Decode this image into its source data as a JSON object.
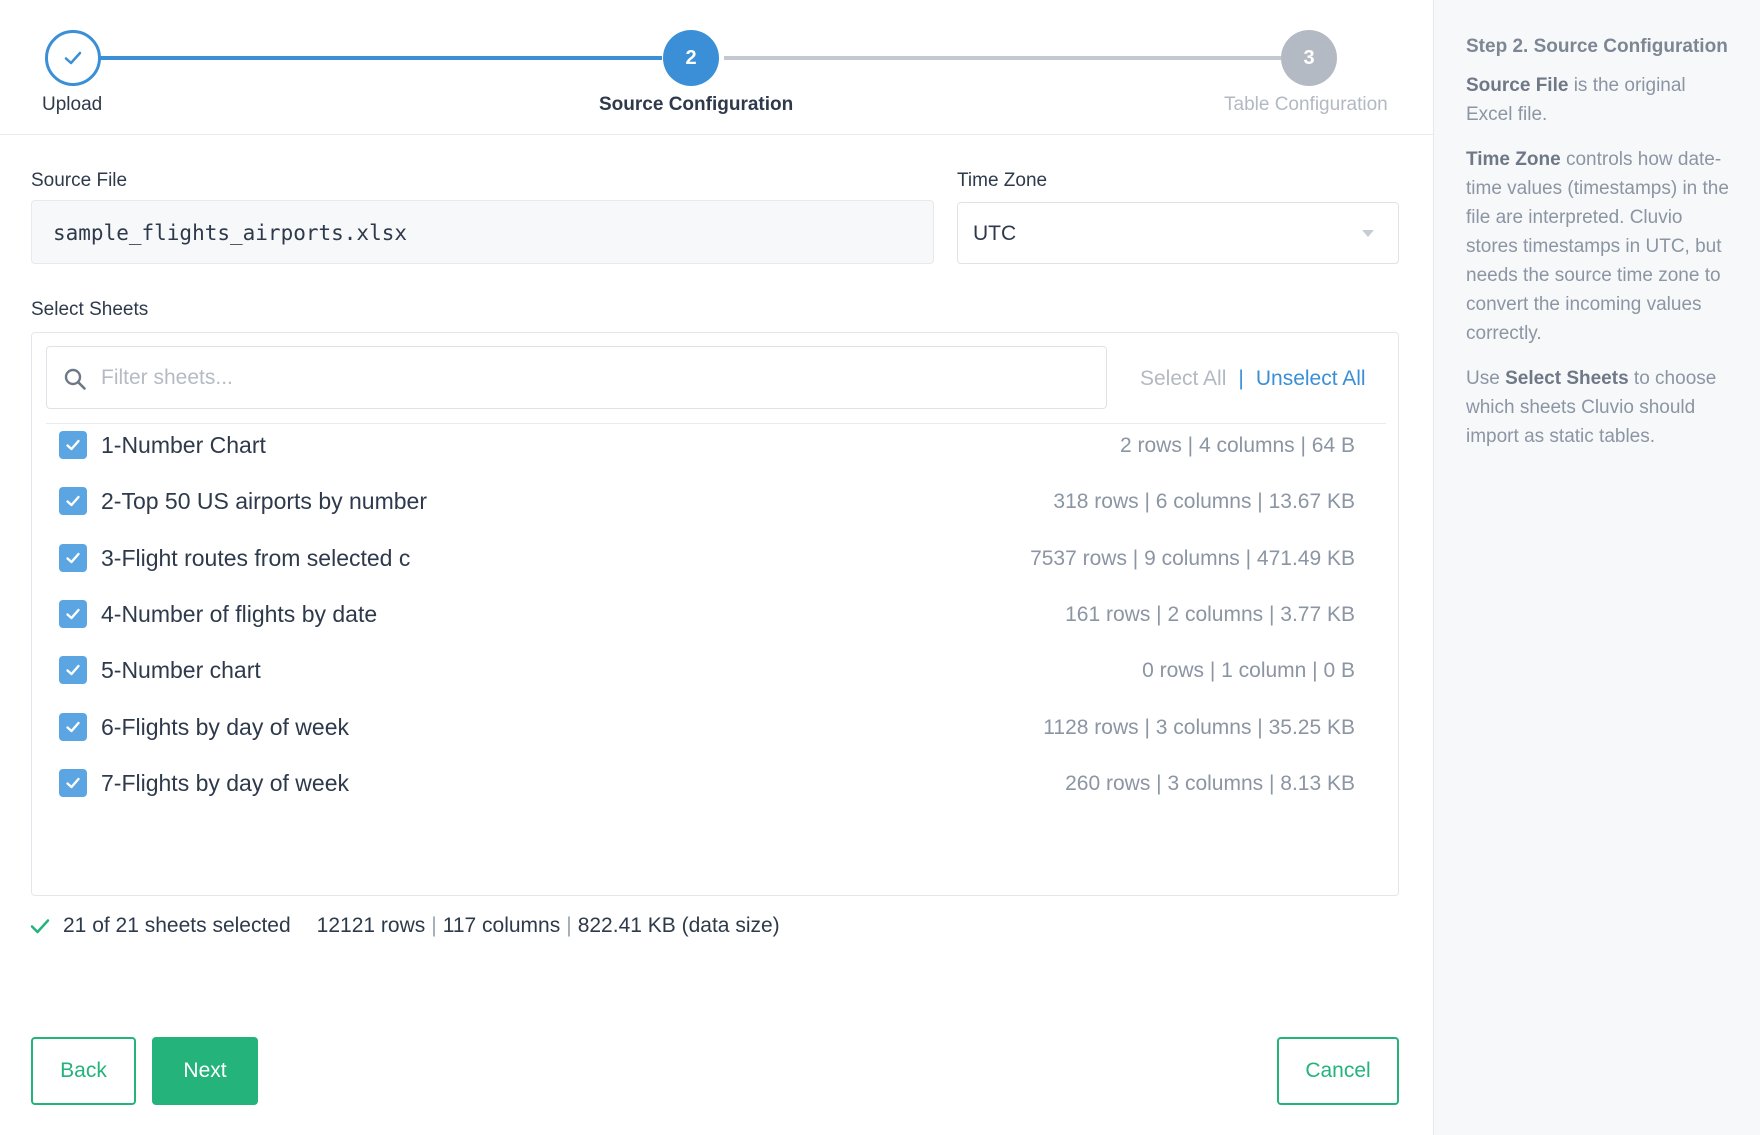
{
  "stepper": {
    "steps": [
      {
        "number": "",
        "label": "Upload",
        "state": "done"
      },
      {
        "number": "2",
        "label": "Source Configuration",
        "state": "active"
      },
      {
        "number": "3",
        "label": "Table Configuration",
        "state": "pending"
      }
    ]
  },
  "source_file": {
    "label": "Source File",
    "value": "sample_flights_airports.xlsx"
  },
  "time_zone": {
    "label": "Time Zone",
    "value": "UTC"
  },
  "sheets": {
    "label": "Select Sheets",
    "filter_placeholder": "Filter sheets...",
    "select_all": "Select All",
    "separator": "|",
    "unselect_all": "Unselect All",
    "items": [
      {
        "name": "1-Number Chart",
        "meta": "2 rows | 4 columns | 64 B",
        "checked": true
      },
      {
        "name": "2-Top 50 US airports by number",
        "meta": "318 rows | 6 columns | 13.67 KB",
        "checked": true
      },
      {
        "name": "3-Flight routes from selected c",
        "meta": "7537 rows | 9 columns | 471.49 KB",
        "checked": true
      },
      {
        "name": "4-Number of flights by date",
        "meta": "161 rows | 2 columns | 3.77 KB",
        "checked": true
      },
      {
        "name": "5-Number chart",
        "meta": "0 rows | 1 column | 0 B",
        "checked": true
      },
      {
        "name": "6-Flights by day of week",
        "meta": "1128 rows | 3 columns | 35.25 KB",
        "checked": true
      },
      {
        "name": "7-Flights by day of week",
        "meta": "260 rows | 3 columns | 8.13 KB",
        "checked": true
      }
    ]
  },
  "summary": {
    "selected": "21 of 21 sheets selected",
    "rows": "12121 rows",
    "columns": "117 columns",
    "size": "822.41 KB (data size)",
    "pipe": "|"
  },
  "buttons": {
    "back": "Back",
    "next": "Next",
    "cancel": "Cancel"
  },
  "help": {
    "title": "Step 2. Source Configuration",
    "p1_bold": "Source File",
    "p1_rest": " is the original Excel file.",
    "p2_bold": "Time Zone",
    "p2_rest": " controls how date-time values (timestamps) in the file are interpreted. Cluvio stores timestamps in UTC, but needs the source time zone to convert the incoming values correctly.",
    "p3_pre": "Use ",
    "p3_bold": "Select Sheets",
    "p3_rest": " to choose which sheets Cluvio should import as static tables."
  },
  "colors": {
    "primary_blue": "#3a8fd6",
    "success_green": "#24b37a",
    "checkbox_blue": "#5ba6e2"
  }
}
